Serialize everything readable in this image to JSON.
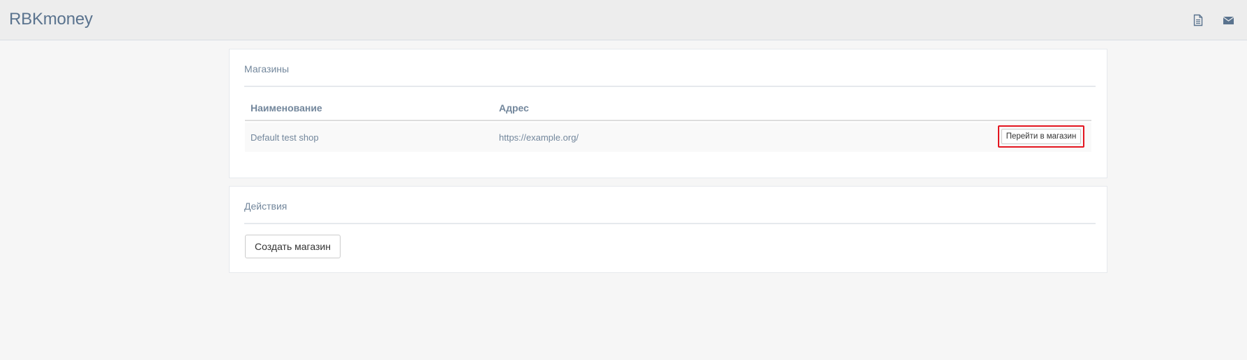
{
  "header": {
    "brand": "RBKmoney",
    "icons": [
      "document-icon",
      "envelope-icon"
    ]
  },
  "shops_panel": {
    "title": "Магазины",
    "columns": [
      "Наименование",
      "Адрес"
    ],
    "rows": [
      {
        "name": "Default test shop",
        "address": "https://example.org/",
        "action_label": "Перейти в магазин"
      }
    ]
  },
  "actions_panel": {
    "title": "Действия",
    "create_label": "Создать магазин"
  },
  "colors": {
    "background": "#f6f6f6",
    "topbar": "#ededed",
    "text": "#73879c",
    "brand": "#5a738e",
    "highlight": "#e3151f"
  }
}
